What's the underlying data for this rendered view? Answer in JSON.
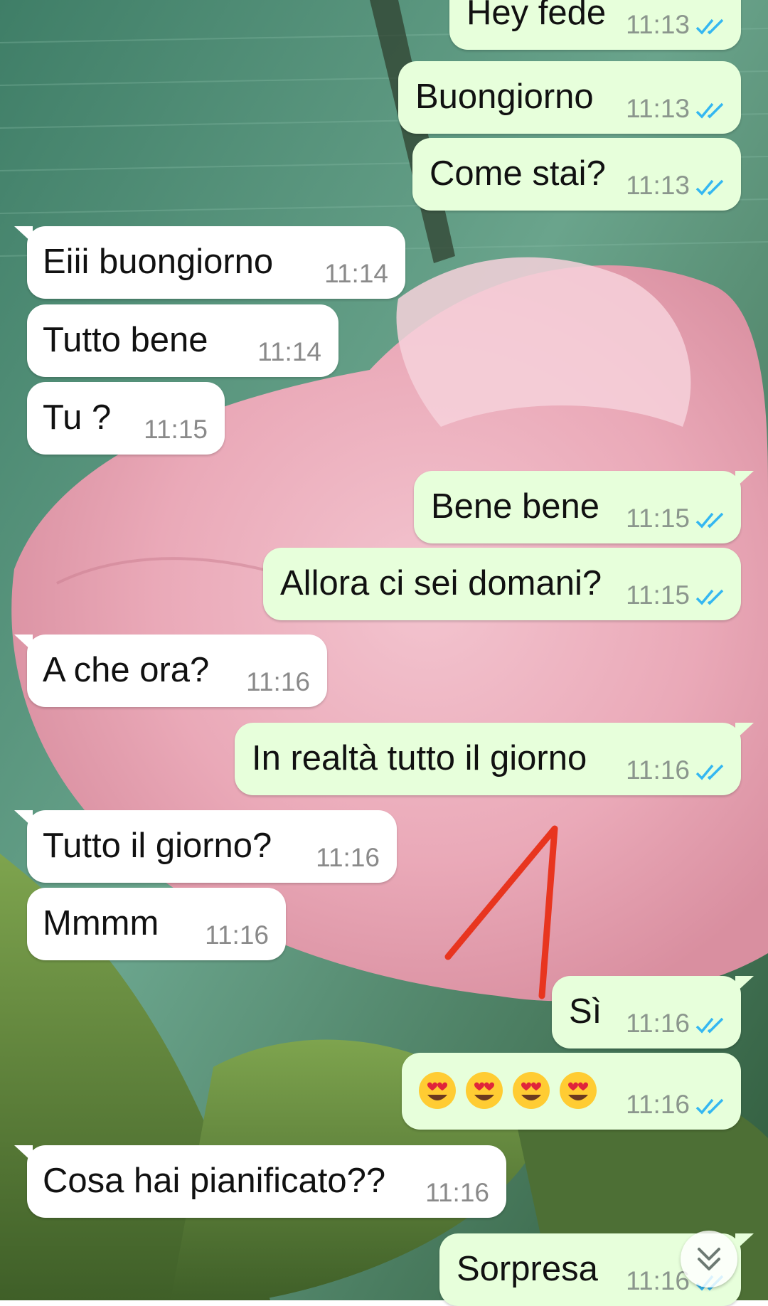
{
  "messages": [
    {
      "dir": "out",
      "text": "Hey fede",
      "time": "11:13"
    },
    {
      "dir": "out",
      "text": "Buongiorno",
      "time": "11:13"
    },
    {
      "dir": "out",
      "text": "Come stai?",
      "time": "11:13"
    },
    {
      "dir": "in",
      "text": "Eiii buongiorno",
      "time": "11:14"
    },
    {
      "dir": "in",
      "text": "Tutto bene",
      "time": "11:14"
    },
    {
      "dir": "in",
      "text": "Tu ?",
      "time": "11:15"
    },
    {
      "dir": "out",
      "text": "Bene bene",
      "time": "11:15"
    },
    {
      "dir": "out",
      "text": "Allora ci sei domani?",
      "time": "11:15"
    },
    {
      "dir": "in",
      "text": "A che ora?",
      "time": "11:16"
    },
    {
      "dir": "out",
      "text": "In realtà tutto il giorno",
      "time": "11:16"
    },
    {
      "dir": "in",
      "text": "Tutto il giorno?",
      "time": "11:16"
    },
    {
      "dir": "in",
      "text": "Mmmm",
      "time": "11:16"
    },
    {
      "dir": "out",
      "text": "Sì",
      "time": "11:16"
    },
    {
      "dir": "out",
      "text": "😍😍😍😍",
      "time": "11:16",
      "emoji": "heart-eyes",
      "emoji_count": 4
    },
    {
      "dir": "in",
      "text": "Cosa hai pianificato??",
      "time": "11:16"
    },
    {
      "dir": "out",
      "text": "Sorpresa",
      "time": "11:16"
    }
  ],
  "icons": {
    "read_receipt": "double-check-icon",
    "scroll_down": "double-chevron-down-icon",
    "annotation": "red-arrow-drawing"
  },
  "colors": {
    "outgoing_bubble": "#e7ffdb",
    "incoming_bubble": "#ffffff",
    "read_tick": "#34b7f1",
    "annotation": "#e8351f"
  }
}
